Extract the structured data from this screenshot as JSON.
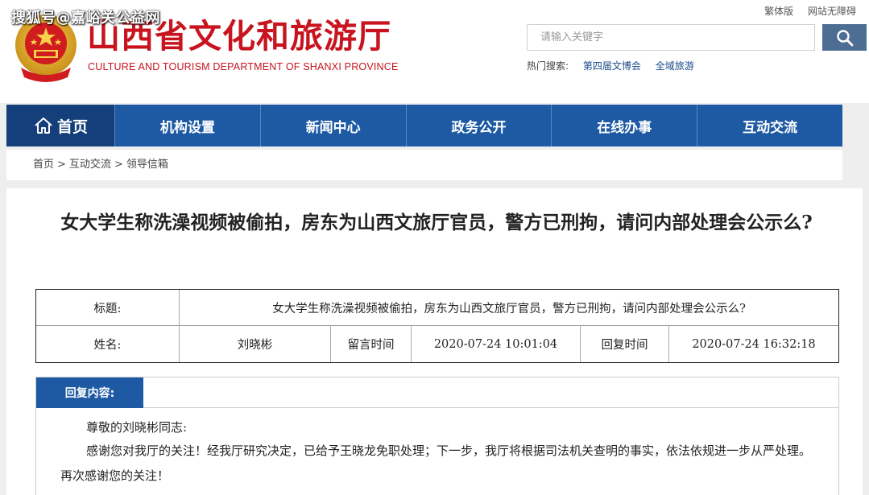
{
  "watermark": "搜狐号@嘉峪关公益网",
  "header": {
    "title": "山西省文化和旅游厅",
    "subtitle": "CULTURE AND TOURISM DEPARTMENT OF SHANXI PROVINCE",
    "top_links": [
      "繁体版",
      "网站无障碍"
    ],
    "search": {
      "placeholder": "请输入关键字"
    },
    "hot_search": {
      "label": "热门搜索:",
      "links": [
        "第四届文博会",
        "全域旅游"
      ]
    }
  },
  "nav": {
    "home": "首页",
    "items": [
      "机构设置",
      "新闻中心",
      "政务公开",
      "在线办事",
      "互动交流"
    ]
  },
  "breadcrumb": [
    "首页",
    "互动交流",
    "领导信箱"
  ],
  "breadcrumb_sep": ">",
  "article": {
    "title": "女大学生称洗澡视频被偷拍，房东为山西文旅厅官员，警方已刑拘，请问内部处理会公示么?"
  },
  "info": {
    "title_label": "标题:",
    "title_value": "女大学生称洗澡视频被偷拍，房东为山西文旅厅官员，警方已刑拘，请问内部处理会公示么?",
    "name_label": "姓名:",
    "name_value": "刘晓彬",
    "msg_time_label": "留言时间",
    "msg_time_value": "2020-07-24 10:01:04",
    "reply_time_label": "回复时间",
    "reply_time_value": "2020-07-24 16:32:18"
  },
  "reply": {
    "header": "回复内容:",
    "greeting": "尊敬的刘晓彬同志:",
    "body": "感谢您对我厅的关注！经我厅研究决定，已给予王晓龙免职处理；下一步，我厅将根据司法机关查明的事实，依法依规进一步从严处理。再次感谢您的关注！"
  },
  "colors": {
    "brand_red": "#c8141e",
    "nav_blue": "#1d5aa3",
    "nav_home_blue": "#143f7a",
    "search_button": "#4d6d93"
  }
}
